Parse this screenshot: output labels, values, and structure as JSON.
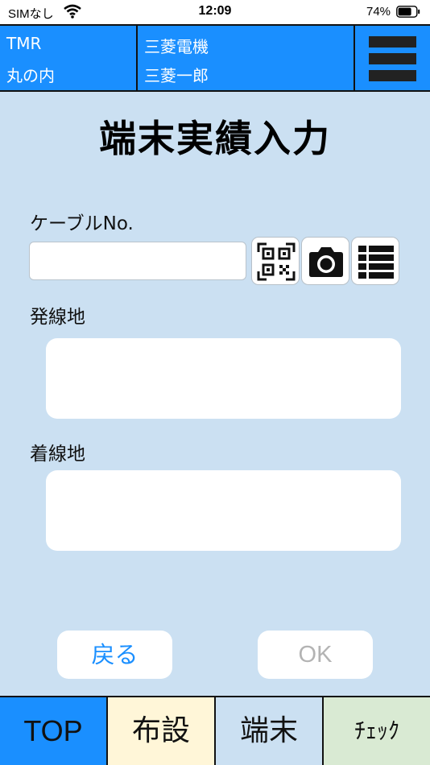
{
  "status_bar": {
    "carrier": "SIMなし",
    "time": "12:09",
    "battery_percent": "74%",
    "battery_level": 0.74
  },
  "header": {
    "org_code": "TMR",
    "location": "丸の内",
    "company": "三菱電機",
    "user_name": "三菱一郎"
  },
  "page": {
    "title": "端末実績入力"
  },
  "form": {
    "cable_no_label": "ケーブルNo.",
    "cable_no_value": "",
    "origin_label": "発線地",
    "origin_value": "",
    "destination_label": "着線地",
    "destination_value": ""
  },
  "actions": {
    "back_label": "戻る",
    "ok_label": "OK"
  },
  "tabs": [
    {
      "label": "TOP",
      "color": "#1a8fff"
    },
    {
      "label": "布設",
      "color": "#fff6d8"
    },
    {
      "label": "端末",
      "color": "#cbe0f2"
    },
    {
      "label": "ﾁｪｯｸ",
      "color": "#d9ead3"
    }
  ],
  "icons": {
    "scan": "qr-code-icon",
    "camera": "camera-icon",
    "list": "list-icon",
    "menu": "hamburger-menu-icon"
  }
}
